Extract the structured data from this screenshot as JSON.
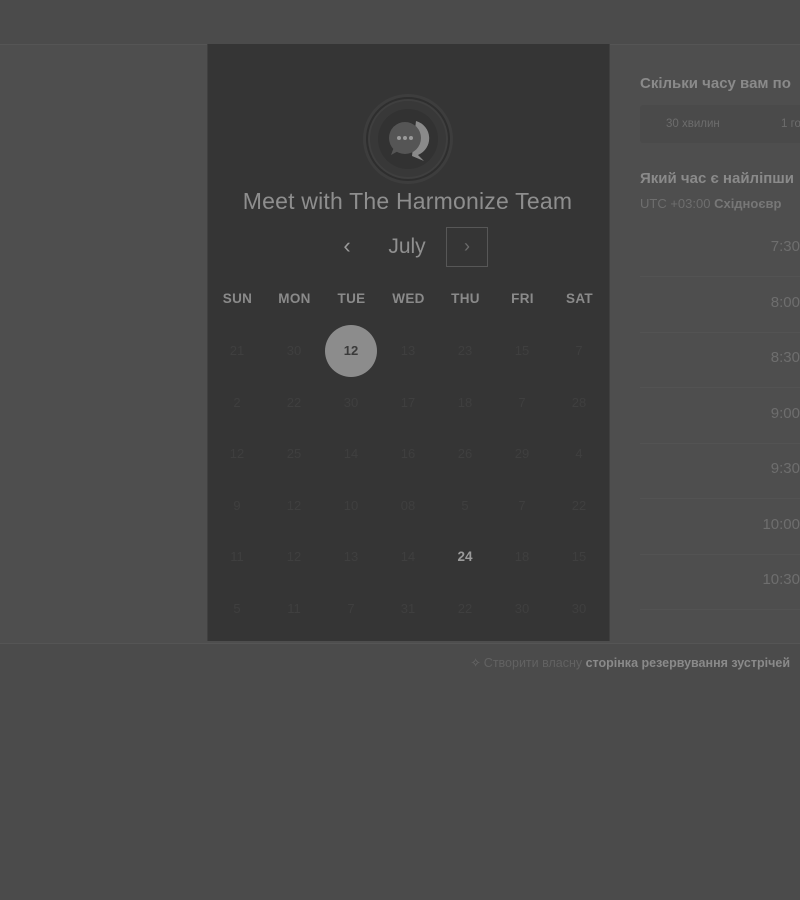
{
  "header": {
    "title": "Meet with The Harmonize Team"
  },
  "calendar": {
    "month": "July",
    "prev_icon": "chevron-left-icon",
    "next_icon": "chevron-right-icon",
    "prev_glyph": "‹",
    "next_glyph": "›",
    "weekdays": [
      "SUN",
      "MON",
      "TUE",
      "WED",
      "THU",
      "FRI",
      "SAT"
    ],
    "weeks": [
      [
        "21",
        "30",
        "12",
        "13",
        "23",
        "15",
        "7"
      ],
      [
        "2",
        "22",
        "30",
        "17",
        "18",
        "7",
        "28"
      ],
      [
        "12",
        "25",
        "14",
        "16",
        "26",
        "29",
        "4"
      ],
      [
        "9",
        "12",
        "10",
        "08",
        "5",
        "7",
        "22"
      ],
      [
        "11",
        "12",
        "13",
        "14",
        "24",
        "18",
        "15"
      ],
      [
        "5",
        "11",
        "7",
        "31",
        "22",
        "30",
        "30"
      ]
    ],
    "selected_day": "12",
    "available_day": "24"
  },
  "duration": {
    "question": "Скільки часу вам по",
    "options": [
      "30 хвилин",
      "1 го"
    ]
  },
  "time": {
    "question": "Який час є найліпши",
    "tz_prefix": "UTC +03:00",
    "tz_name": "Східноєвр",
    "slots": [
      "7:30",
      "8:00",
      "8:30",
      "9:00",
      "9:30",
      "10:00",
      "10:30"
    ]
  },
  "footer": {
    "icon": "sparkle-icon",
    "glyph": "✧",
    "text": "Створити власну",
    "link": "сторінка резервування зустрічей"
  },
  "colors": {
    "card_background": "#353535",
    "page_background": "#4b4b4b",
    "selected_day": "#8c8c8c"
  }
}
